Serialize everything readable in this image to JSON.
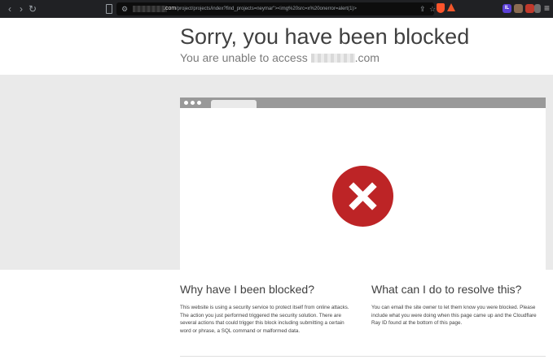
{
  "browser": {
    "url_domain": ".com",
    "url_path": "/project/projects/index?find_projects=neymar\"><img%20src=x%20onerror=alert(1)>",
    "nav_back": "‹",
    "nav_forward": "›",
    "nav_reload": "↻",
    "site_settings_glyph": "⚙",
    "share_glyph": "⇪",
    "star_glyph": "☆",
    "menu_glyph": "≡",
    "extensions": [
      {
        "label": "IL",
        "color": "#5b3fd6"
      },
      {
        "label": "",
        "color": "#8a6b52"
      },
      {
        "label": "",
        "color": "#c0392b"
      },
      {
        "label": "",
        "color": "#6e6e6e"
      }
    ],
    "icons": [
      "back-icon",
      "forward-icon",
      "reload-icon",
      "bookmark-icon",
      "site-settings-icon",
      "share-icon",
      "bookmark-star-icon",
      "brave-shield-icon",
      "brave-rewards-icon",
      "menu-icon"
    ]
  },
  "page": {
    "headline": "Sorry, you have been blocked",
    "subheadline_prefix": "You are unable to access",
    "subheadline_suffix": ".com",
    "why_title": "Why have I been blocked?",
    "why_text": "This website is using a security service to protect itself from online attacks. The action you just performed triggered the security solution. There are several actions that could trigger this block including submitting a certain word or phrase, a SQL command or malformed data.",
    "resolve_title": "What can I do to resolve this?",
    "resolve_text": "You can email the site owner to let them know you were blocked. Please include what you were doing when this page came up and the Cloudflare Ray ID found at the bottom of this page.",
    "blocked_icon": "blocked-x-icon"
  },
  "colors": {
    "chrome_bg": "#202124",
    "headline": "#404040",
    "grey_band": "#eaeaea",
    "window_bar": "#999999",
    "blocked_red": "#bd2426"
  }
}
